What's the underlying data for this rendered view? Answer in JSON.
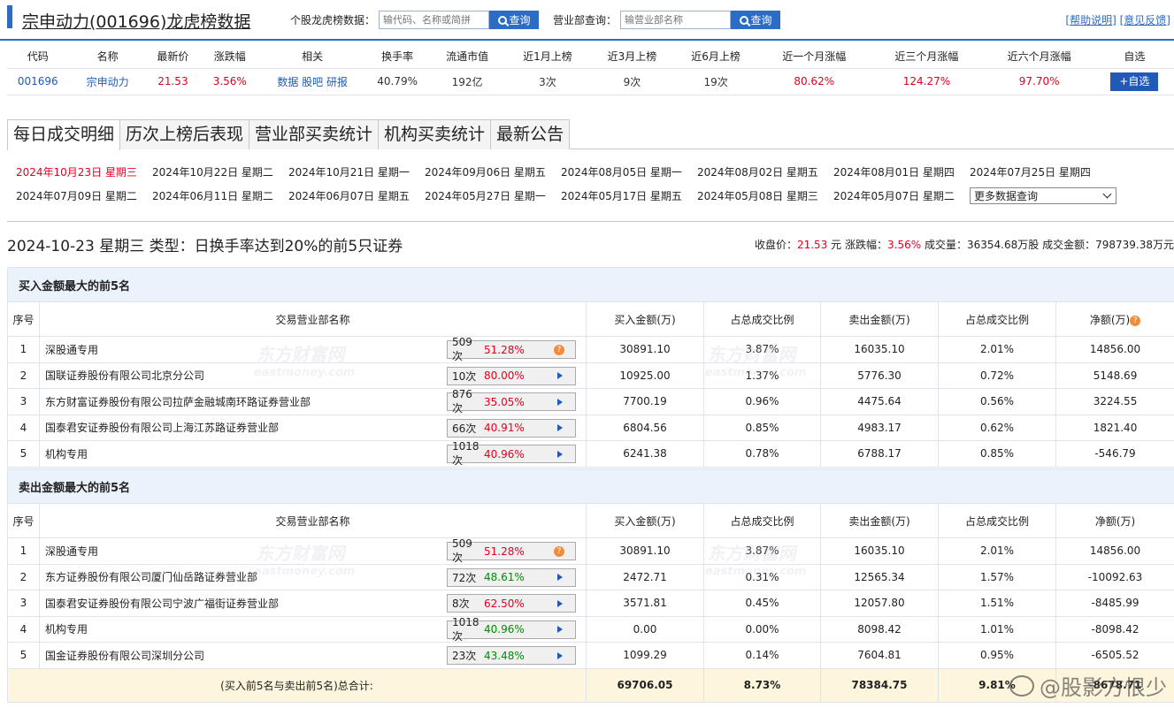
{
  "header": {
    "title": "宗申动力(001696)龙虎榜数据",
    "stock_search_label": "个股龙虎榜数据：",
    "stock_search_placeholder": "输代码、名称或简拼",
    "search_button": "查询",
    "broker_search_label": "营业部查询：",
    "broker_search_placeholder": "输营业部名称",
    "help_link": "[帮助说明]",
    "feedback_link": "[意见反馈]"
  },
  "stock": {
    "headers": [
      "代码",
      "名称",
      "最新价",
      "涨跌幅",
      "相关",
      "换手率",
      "流通市值",
      "近1月上榜",
      "近3月上榜",
      "近6月上榜",
      "近一个月涨幅",
      "近三个月涨幅",
      "近六个月涨幅",
      "自选"
    ],
    "code": "001696",
    "name": "宗申动力",
    "price": "21.53",
    "change": "3.56%",
    "related": [
      "数据",
      "股吧",
      "研报"
    ],
    "turnover": "40.79%",
    "float_cap": "192亿",
    "m1": "3次",
    "m3": "9次",
    "m6": "19次",
    "r1": "80.62%",
    "r3": "124.27%",
    "r6": "97.70%",
    "add_button": "+自选"
  },
  "tabs": [
    "每日成交明细",
    "历次上榜后表现",
    "营业部买卖统计",
    "机构买卖统计",
    "最新公告"
  ],
  "dates": {
    "row1": [
      "2024年10月23日  星期三",
      "2024年10月22日  星期二",
      "2024年10月21日  星期一",
      "2024年09月06日  星期五",
      "2024年08月05日  星期一",
      "2024年08月02日  星期五",
      "2024年08月01日  星期四",
      "2024年07月25日  星期四"
    ],
    "row2": [
      "2024年07月09日  星期二",
      "2024年06月11日  星期二",
      "2024年06月07日  星期五",
      "2024年05月27日  星期一",
      "2024年05月17日  星期五",
      "2024年05月08日  星期三",
      "2024年05月07日  星期二"
    ],
    "more": "更多数据查询"
  },
  "section": {
    "heading": "2024-10-23 星期三 类型：日换手率达到20%的前5只证券",
    "close_label": "收盘价：",
    "close_value": "21.53",
    "close_unit": "元",
    "chg_label": "涨跌幅：",
    "chg_value": "3.56%",
    "vol_label": "成交量：",
    "vol_value": "36354.68万股",
    "amt_label": "成交金额：",
    "amt_value": "798739.38万元"
  },
  "columns": [
    "序号",
    "交易营业部名称",
    "买入金额(万)",
    "占总成交比例",
    "卖出金额(万)",
    "占总成交比例",
    "净额(万)"
  ],
  "buy_table": {
    "caption": "买入金额最大的前5名",
    "rows": [
      {
        "idx": "1",
        "name": "深股通专用",
        "cnt": "509次",
        "pct": "51.28%",
        "buy": "30891.10",
        "buy_r": "3.87%",
        "sell": "16035.10",
        "sell_r": "2.01%",
        "net": "14856.00"
      },
      {
        "idx": "2",
        "name": "国联证券股份有限公司北京分公司",
        "cnt": "10次",
        "pct": "80.00%",
        "buy": "10925.00",
        "buy_r": "1.37%",
        "sell": "5776.30",
        "sell_r": "0.72%",
        "net": "5148.69"
      },
      {
        "idx": "3",
        "name": "东方财富证券股份有限公司拉萨金融城南环路证券营业部",
        "cnt": "876次",
        "pct": "35.05%",
        "buy": "7700.19",
        "buy_r": "0.96%",
        "sell": "4475.64",
        "sell_r": "0.56%",
        "net": "3224.55"
      },
      {
        "idx": "4",
        "name": "国泰君安证券股份有限公司上海江苏路证券营业部",
        "cnt": "66次",
        "pct": "40.91%",
        "buy": "6804.56",
        "buy_r": "0.85%",
        "sell": "4983.17",
        "sell_r": "0.62%",
        "net": "1821.40"
      },
      {
        "idx": "5",
        "name": "机构专用",
        "cnt": "1018次",
        "pct": "40.96%",
        "buy": "6241.38",
        "buy_r": "0.78%",
        "sell": "6788.17",
        "sell_r": "0.85%",
        "net": "-546.79"
      }
    ]
  },
  "sell_table": {
    "caption": "卖出金额最大的前5名",
    "rows": [
      {
        "idx": "1",
        "name": "深股通专用",
        "cnt": "509次",
        "pct": "51.28%",
        "buy": "30891.10",
        "buy_r": "3.87%",
        "sell": "16035.10",
        "sell_r": "2.01%",
        "net": "14856.00"
      },
      {
        "idx": "2",
        "name": "东方证券股份有限公司厦门仙岳路证券营业部",
        "cnt": "72次",
        "pct": "48.61%",
        "buy": "2472.71",
        "buy_r": "0.31%",
        "sell": "12565.34",
        "sell_r": "1.57%",
        "net": "-10092.63"
      },
      {
        "idx": "3",
        "name": "国泰君安证券股份有限公司宁波广福街证券营业部",
        "cnt": "8次",
        "pct": "62.50%",
        "buy": "3571.81",
        "buy_r": "0.45%",
        "sell": "12057.80",
        "sell_r": "1.51%",
        "net": "-8485.99"
      },
      {
        "idx": "4",
        "name": "机构专用",
        "cnt": "1018次",
        "pct": "40.96%",
        "buy": "0.00",
        "buy_r": "0.00%",
        "sell": "8098.42",
        "sell_r": "1.01%",
        "net": "-8098.42"
      },
      {
        "idx": "5",
        "name": "国金证券股份有限公司深圳分公司",
        "cnt": "23次",
        "pct": "43.48%",
        "buy": "1099.29",
        "buy_r": "0.14%",
        "sell": "7604.81",
        "sell_r": "0.95%",
        "net": "-6505.52"
      }
    ],
    "total_label": "(买入前5名与卖出前5名)总合计:",
    "total_buy": "69706.05",
    "total_buy_r": "8.73%",
    "total_sell": "78384.75",
    "total_sell_r": "9.81%",
    "total_net": "-8678.71"
  },
  "watermark": {
    "cn": "东方财富网",
    "en": "eastmoney.com",
    "weibo": "@股影方恨少"
  },
  "colors": {
    "accent": "#2b6cc4",
    "up": "#e4001f",
    "down": "#008c00",
    "caption_bg": "#eaf2fb",
    "total_bg": "#fdf6dc"
  }
}
